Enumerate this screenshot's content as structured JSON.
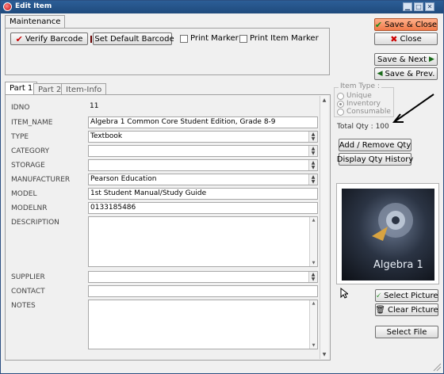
{
  "window": {
    "title": "Edit Item"
  },
  "top_tab": {
    "label": "Maintenance"
  },
  "toolbar": {
    "verify_barcode": "Verify Barcode",
    "set_default_barcode": "Set Default Barcode",
    "print_marker": "Print Marker",
    "print_item_marker": "Print Item Marker"
  },
  "actions": {
    "save_close": "Save & Close",
    "close": "Close",
    "save_next": "Save & Next",
    "save_prev": "Save & Prev."
  },
  "tabs": [
    "Part 1",
    "Part 2",
    "Item-Info"
  ],
  "fields": {
    "idno": {
      "label": "IDNO",
      "value": "11"
    },
    "item_name": {
      "label": "ITEM_NAME",
      "value": "Algebra 1 Common Core Student Edition, Grade 8-9"
    },
    "type": {
      "label": "TYPE",
      "value": "Textbook"
    },
    "category": {
      "label": "CATEGORY",
      "value": ""
    },
    "storage": {
      "label": "STORAGE",
      "value": ""
    },
    "manufacturer": {
      "label": "MANUFACTURER",
      "value": "Pearson Education"
    },
    "model": {
      "label": "MODEL",
      "value": "1st Student Manual/Study Guide"
    },
    "modelnr": {
      "label": "MODELNR",
      "value": "0133185486"
    },
    "description": {
      "label": "DESCRIPTION",
      "value": ""
    },
    "supplier": {
      "label": "SUPPLIER",
      "value": ""
    },
    "contact": {
      "label": "CONTACT",
      "value": ""
    },
    "notes": {
      "label": "NOTES",
      "value": ""
    }
  },
  "item_type": {
    "legend": "Item Type :",
    "options": [
      "Unique",
      "Inventory",
      "Consumable"
    ],
    "selected": "Inventory"
  },
  "quantity": {
    "total_text": "Total Qty : 100",
    "add_remove": "Add / Remove Qty",
    "display_history": "Display Qty History"
  },
  "picture": {
    "cover_title": "Algebra 1",
    "select_picture": "Select Picture",
    "clear_picture": "Clear Picture",
    "select_file": "Select File"
  },
  "colors": {
    "title_bar": "#1f4a7c",
    "primary_button": "#f07a4a",
    "annotation_arrow": "#000000"
  }
}
